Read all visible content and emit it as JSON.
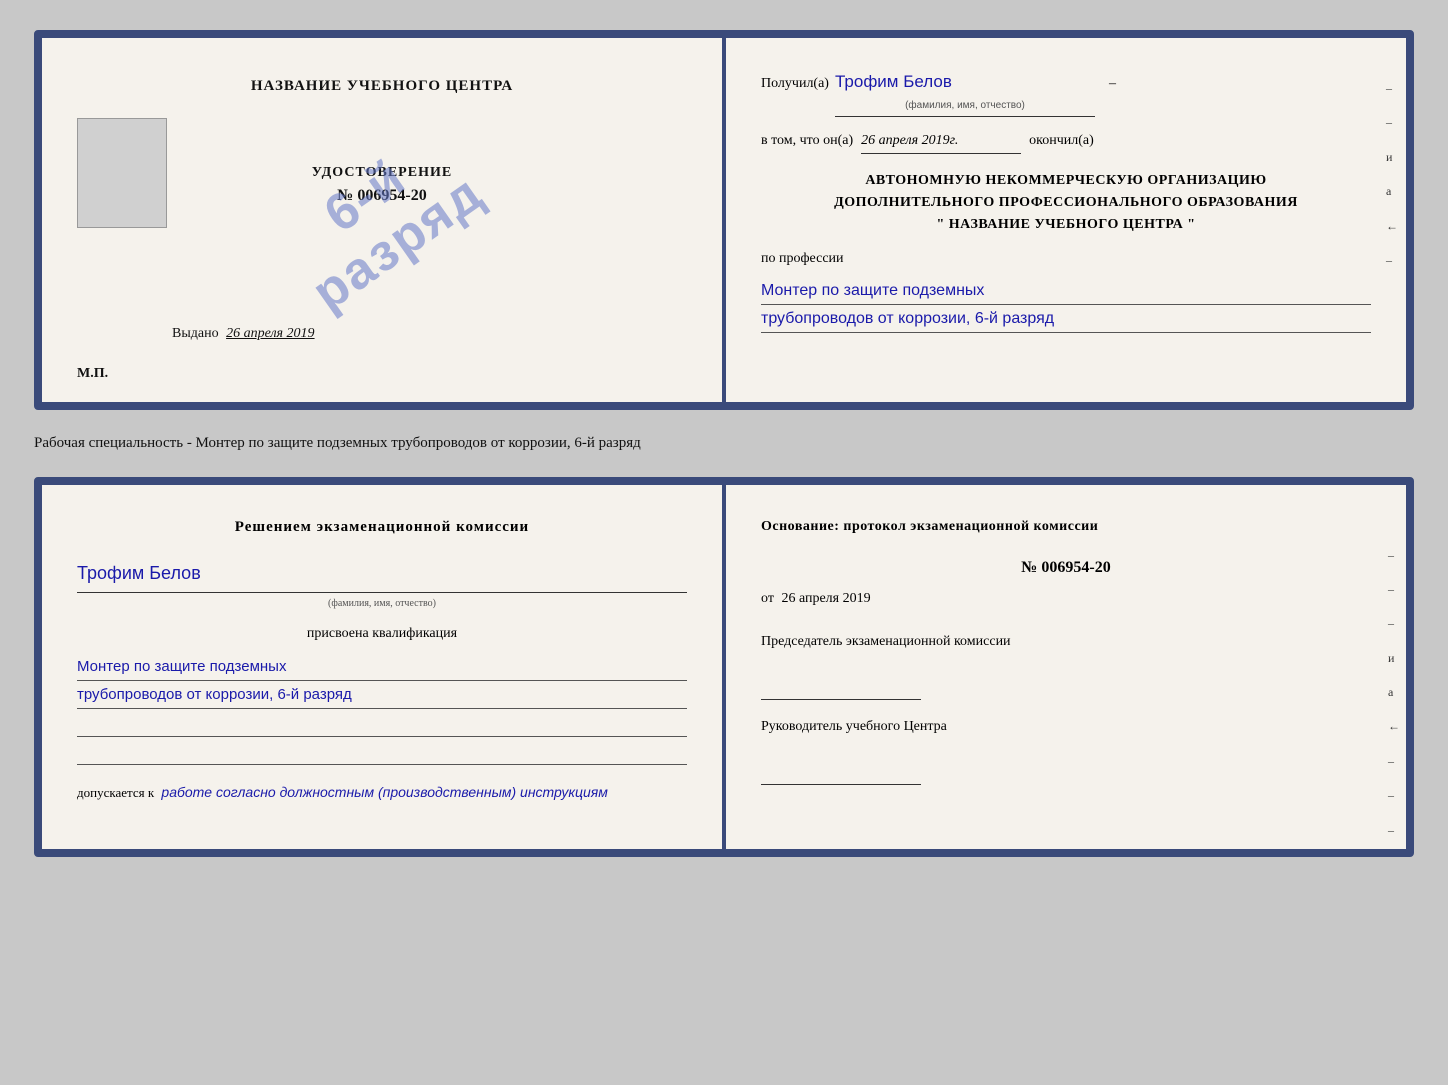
{
  "top_doc": {
    "left": {
      "center_title": "НАЗВАНИЕ УЧЕБНОГО ЦЕНТРА",
      "cert_label": "УДОСТОВЕРЕНИЕ",
      "cert_number": "№ 006954-20",
      "stamp_line1": "6-й",
      "stamp_line2": "разряд",
      "issued_prefix": "Выдано",
      "issued_date": "26 апреля 2019",
      "mp_label": "М.П."
    },
    "right": {
      "recipient_prefix": "Получил(а)",
      "recipient_name": "Трофим Белов",
      "recipient_sublabel": "(фамилия, имя, отчество)",
      "date_prefix": "в том, что он(а)",
      "date_value": "26 апреля 2019г.",
      "date_suffix": "окончил(а)",
      "org_line1": "АВТОНОМНУЮ НЕКОММЕРЧЕСКУЮ ОРГАНИЗАЦИЮ",
      "org_line2": "ДОПОЛНИТЕЛЬНОГО ПРОФЕССИОНАЛЬНОГО ОБРАЗОВАНИЯ",
      "org_name": "\" НАЗВАНИЕ УЧЕБНОГО ЦЕНТРА \"",
      "profession_label": "по профессии",
      "profession_line1": "Монтер по защите подземных",
      "profession_line2": "трубопроводов от коррозии, 6-й разряд",
      "side_marks": [
        "–",
        "–",
        "и",
        "а",
        "←",
        "–"
      ]
    }
  },
  "middle_text": "Рабочая специальность - Монтер по защите подземных трубопроводов от коррозии, 6-й разряд",
  "bottom_doc": {
    "left": {
      "commission_title": "Решением экзаменационной комиссии",
      "person_name": "Трофим Белов",
      "person_sublabel": "(фамилия, имя, отчество)",
      "assigned_label": "присвоена квалификация",
      "qualification_line1": "Монтер по защите подземных",
      "qualification_line2": "трубопроводов от коррозии, 6-й разряд",
      "allowed_prefix": "допускается к",
      "allowed_italic": "работе согласно должностным (производственным) инструкциям"
    },
    "right": {
      "basis_title": "Основание: протокол экзаменационной комиссии",
      "protocol_number": "№ 006954-20",
      "from_prefix": "от",
      "from_date": "26 апреля 2019",
      "chairman_title": "Председатель экзаменационной комиссии",
      "director_title": "Руководитель учебного Центра",
      "side_marks": [
        "–",
        "–",
        "–",
        "и",
        "а",
        "←",
        "–",
        "–",
        "–"
      ]
    }
  }
}
